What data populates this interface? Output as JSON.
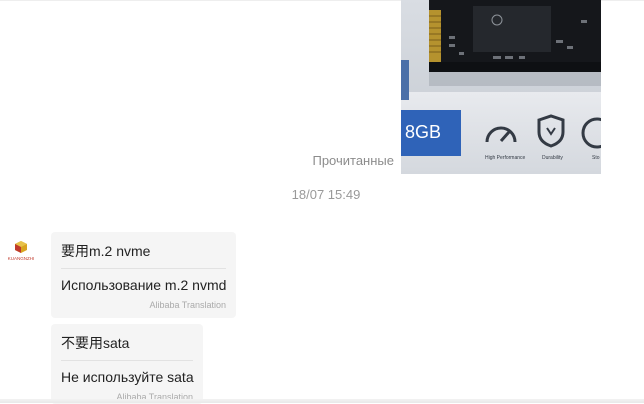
{
  "chat": {
    "read_status": "Прочитанные",
    "timestamp": "18/07 15:49",
    "sent_image": {
      "capacity_text": "8GB",
      "feature_labels": [
        "High Performance",
        "Durability",
        "Sto"
      ]
    },
    "messages": [
      {
        "original": "要用m.2 nvme",
        "translation": "Использование m.2 nvmd",
        "translator": "Alibaba Translation"
      },
      {
        "original": "不要用sata",
        "translation": "Не используйте sata",
        "translator": "Alibaba Translation"
      }
    ],
    "avatar": {
      "brand_text": "KUANGNZHI"
    }
  }
}
